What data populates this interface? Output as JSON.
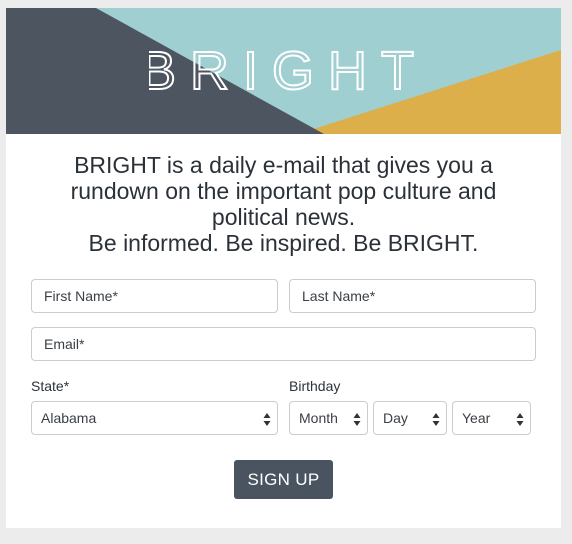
{
  "banner": {
    "brand_text": "BRIGHT",
    "colors": {
      "teal": "#9fcfd1",
      "slate": "#4c5560",
      "gold": "#dcaf4a"
    }
  },
  "headline": {
    "line1": "BRIGHT is a daily e-mail that gives you a",
    "line2": "rundown on the important pop culture and",
    "line3": "political news.",
    "line4": "Be informed. Be inspired. Be BRIGHT."
  },
  "form": {
    "first_name_placeholder": "First Name*",
    "last_name_placeholder": "Last Name*",
    "email_placeholder": "Email*",
    "state_label": "State*",
    "state_value": "Alabama",
    "birthday_label": "Birthday",
    "month_value": "Month",
    "day_value": "Day",
    "year_value": "Year",
    "signup_label": "SIGN UP"
  }
}
